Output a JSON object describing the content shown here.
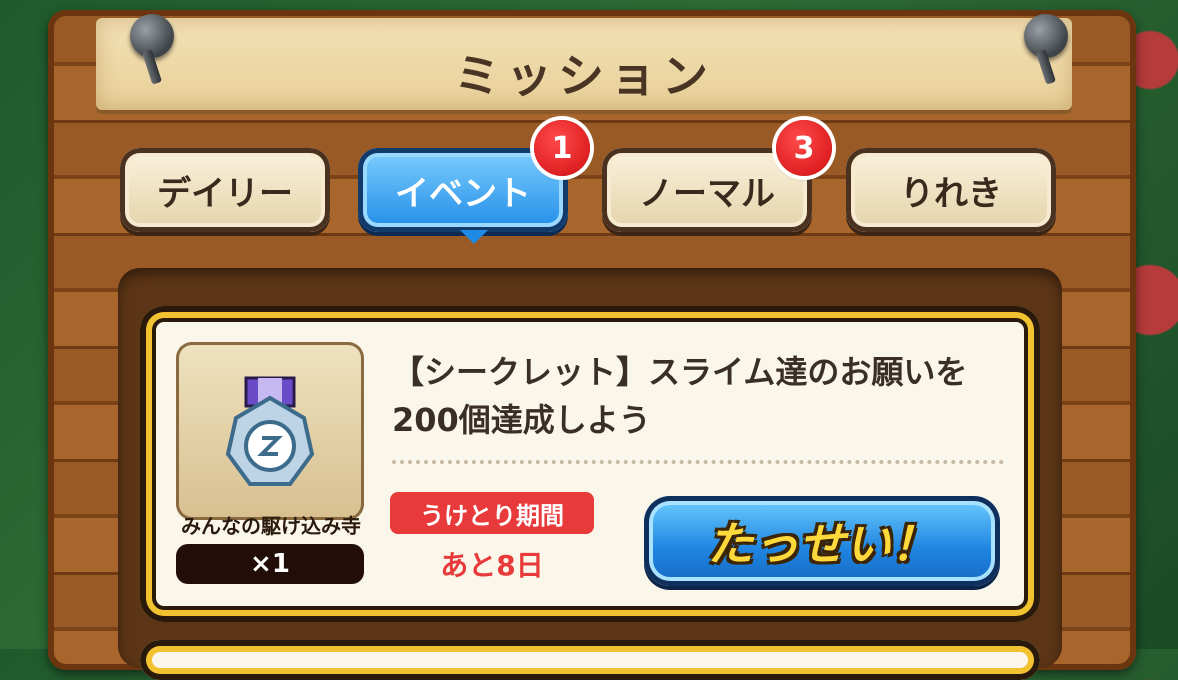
{
  "header": {
    "title": "ミッション"
  },
  "tabs": [
    {
      "label": "デイリー",
      "badge": ""
    },
    {
      "label": "イベント",
      "badge": "1",
      "active": true
    },
    {
      "label": "ノーマル",
      "badge": "3"
    },
    {
      "label": "りれき",
      "badge": ""
    }
  ],
  "mission": {
    "title": "【シークレット】スライム達のお願いを200個達成しよう",
    "reward": {
      "icon": "medal-icon",
      "name": "みんなの駆け込み寺",
      "count": "×1"
    },
    "period_label": "うけとり期間",
    "period_value": "あと8日",
    "action_label": "たっせい！"
  },
  "colors": {
    "active_tab": "#1f8be6",
    "badge": "#d10e12",
    "period": "#e83a3a",
    "card_border": "#f2c230"
  }
}
